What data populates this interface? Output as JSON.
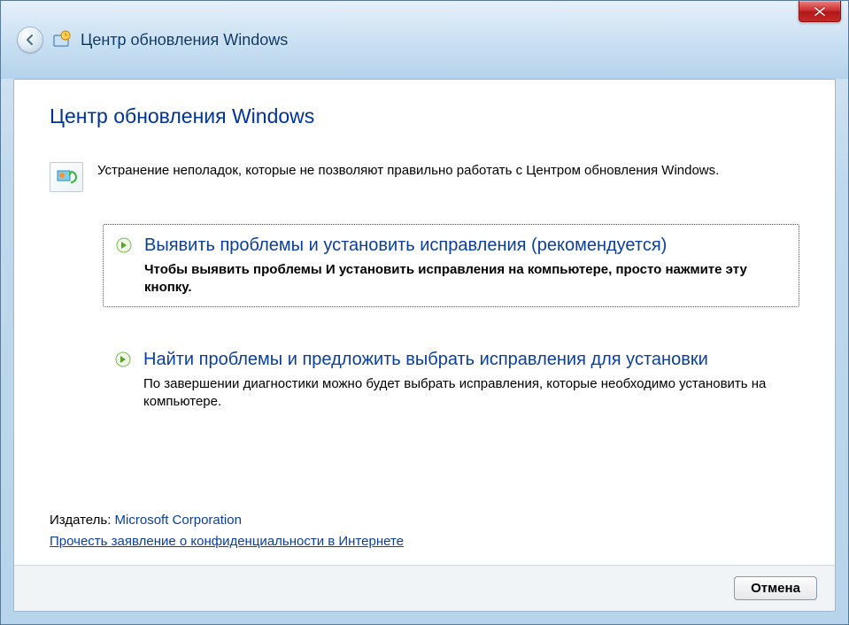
{
  "window": {
    "header_title": "Центр обновления Windows"
  },
  "page": {
    "title": "Центр обновления Windows",
    "subtitle": "Устранение неполадок, которые не позволяют правильно работать с Центром обновления Windows."
  },
  "options": [
    {
      "title": "Выявить проблемы и установить исправления (рекомендуется)",
      "description": "Чтобы выявить проблемы И установить исправления на компьютере, просто нажмите эту кнопку."
    },
    {
      "title": "Найти проблемы и предложить выбрать исправления для установки",
      "description": "По завершении диагностики можно будет выбрать исправления, которые необходимо установить на компьютере."
    }
  ],
  "publisher": {
    "label": "Издатель: ",
    "name": "Microsoft Corporation",
    "privacy_link": "Прочесть заявление о конфиденциальности в Интернете"
  },
  "footer": {
    "cancel": "Отмена"
  }
}
